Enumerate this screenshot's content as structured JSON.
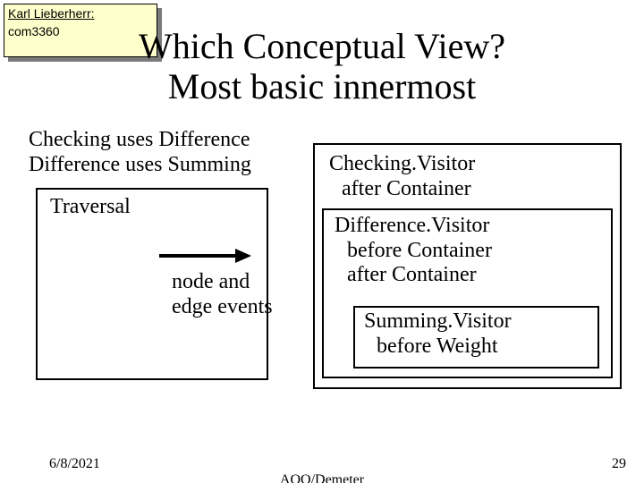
{
  "note": {
    "author": "Karl Lieberherr:",
    "body": "com3360"
  },
  "title": {
    "line1": "Which Conceptual View?",
    "line2": "Most basic innermost"
  },
  "body": {
    "line1": "Checking uses Difference",
    "line2": "Difference uses Summing"
  },
  "traversal": {
    "label": "Traversal"
  },
  "arrow": {
    "label_line1": "node and",
    "label_line2": "edge events"
  },
  "outer": {
    "line1": "Checking.Visitor",
    "line2": "after Container"
  },
  "mid": {
    "line1": "Difference.Visitor",
    "line2": "before Container",
    "line3": "after Container"
  },
  "inner": {
    "line1": "Summing.Visitor",
    "line2": "before Weight"
  },
  "footer": {
    "date": "6/8/2021",
    "center": "AOO/Demeter",
    "page": "29"
  }
}
